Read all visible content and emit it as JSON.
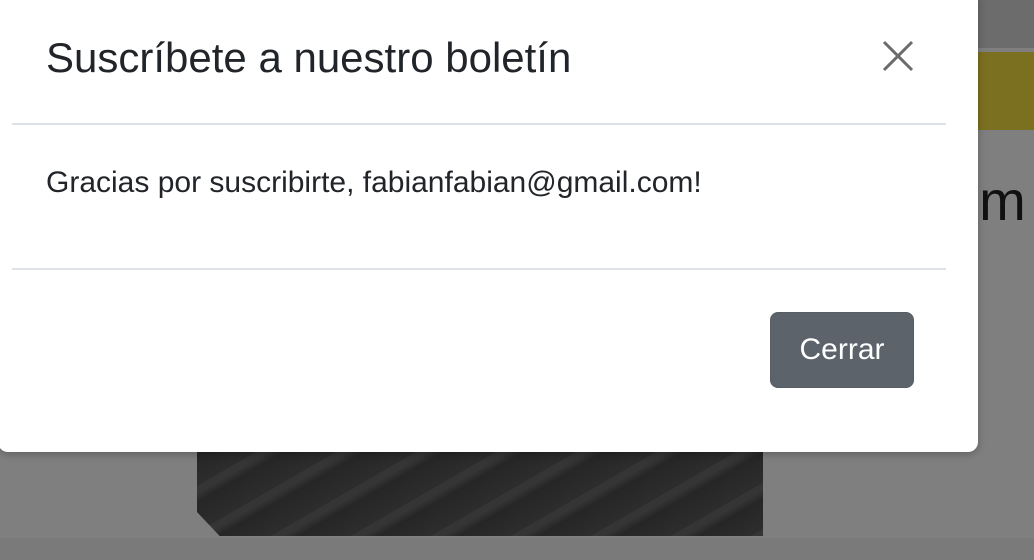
{
  "modal": {
    "title": "Suscríbete a nuestro boletín",
    "message": "Gracias por suscribirte, fabianfabian@gmail.com!",
    "close_button_label": "Cerrar"
  },
  "background": {
    "heading_fragment": "om",
    "banner_color": "#f7e040"
  },
  "icons": {
    "close": "close-icon"
  },
  "colors": {
    "secondary_button": "#5c636a",
    "overlay": "rgba(0,0,0,0.5)"
  }
}
